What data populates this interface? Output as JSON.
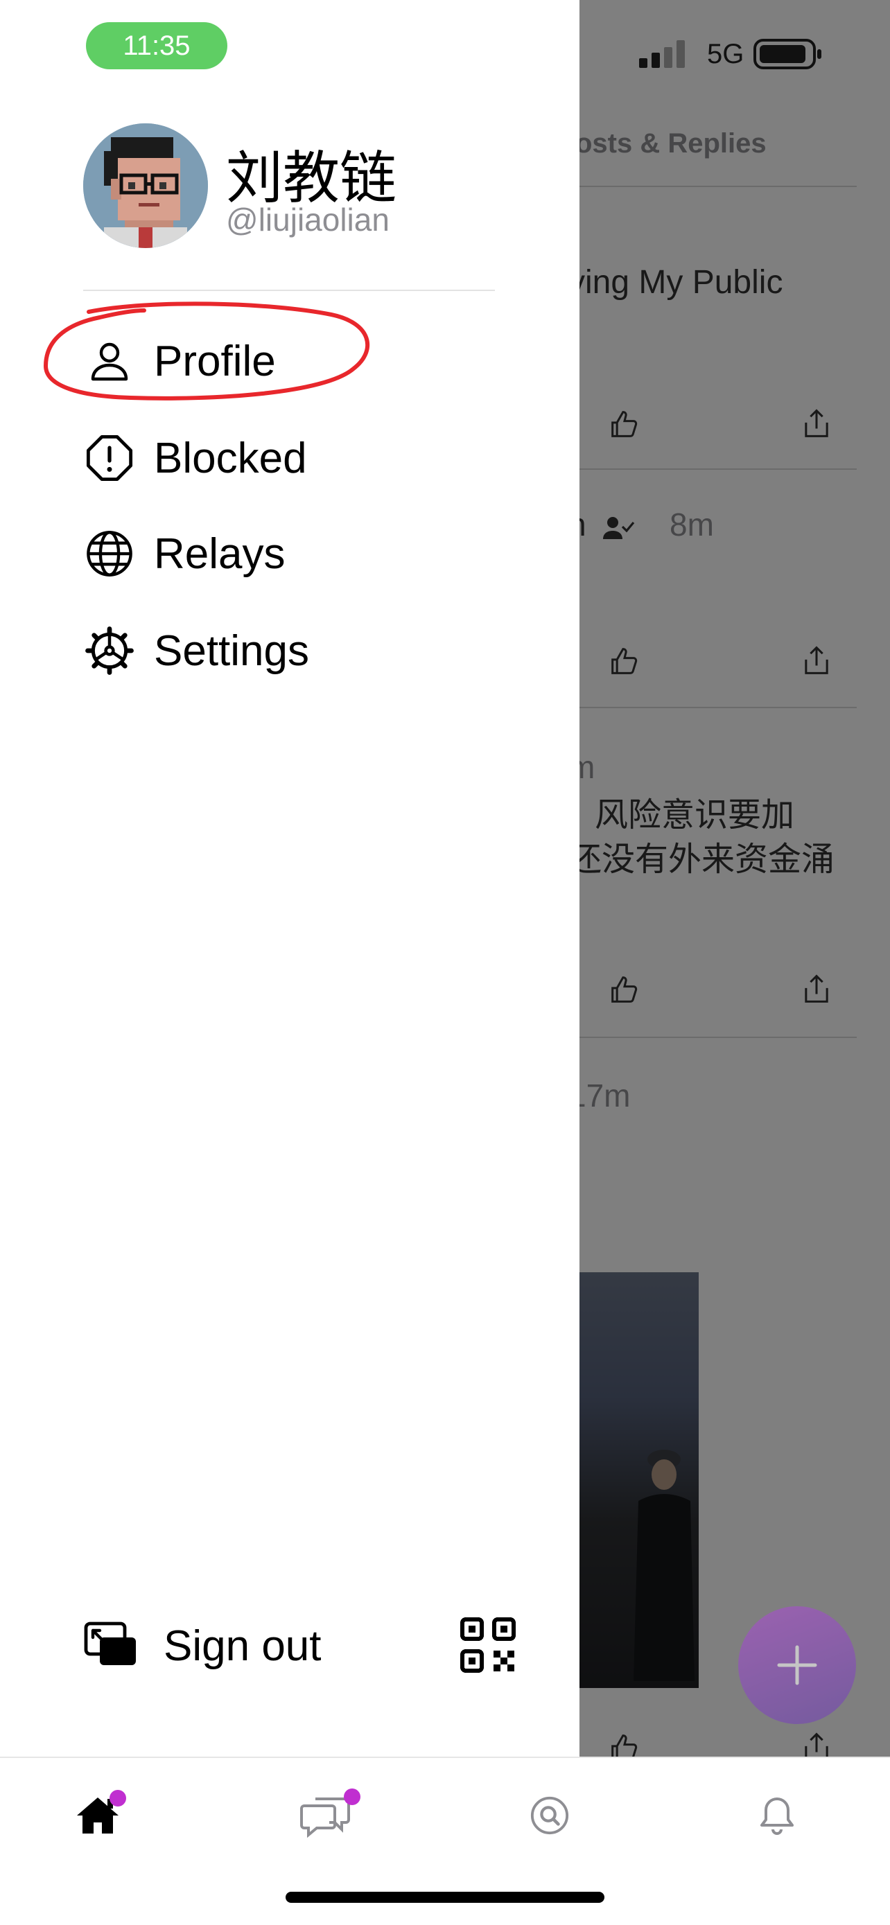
{
  "status_bar": {
    "time": "11:35",
    "network": "5G"
  },
  "drawer": {
    "display_name": "刘教链",
    "handle": "@liujiaolian",
    "menu": [
      {
        "label": "Profile",
        "icon": "person-icon"
      },
      {
        "label": "Blocked",
        "icon": "blocked-octagon-icon"
      },
      {
        "label": "Relays",
        "icon": "globe-icon"
      },
      {
        "label": "Settings",
        "icon": "gear-icon"
      }
    ],
    "sign_out_label": "Sign out",
    "annotation_color": "#e8272c"
  },
  "feed": {
    "tab_label": "osts & Replies",
    "post1_text": "ying My Public",
    "post2_meta": "n",
    "post2_time": "8m",
    "post3_meta": "m",
    "post3_line1": "风险意识要加",
    "post3_line2": "还没有外来资金涌",
    "post4_time": "17m"
  },
  "tabbar": {
    "items": [
      {
        "name": "home",
        "icon": "home-icon",
        "badge": true
      },
      {
        "name": "messages",
        "icon": "chat-bubbles-icon",
        "badge": true
      },
      {
        "name": "search",
        "icon": "search-icon",
        "badge": false
      },
      {
        "name": "notifications",
        "icon": "bell-icon",
        "badge": false
      }
    ],
    "badge_color": "#c02fd0"
  },
  "colors": {
    "accent": "#8a3ec9",
    "time_pill": "#5fce64"
  }
}
